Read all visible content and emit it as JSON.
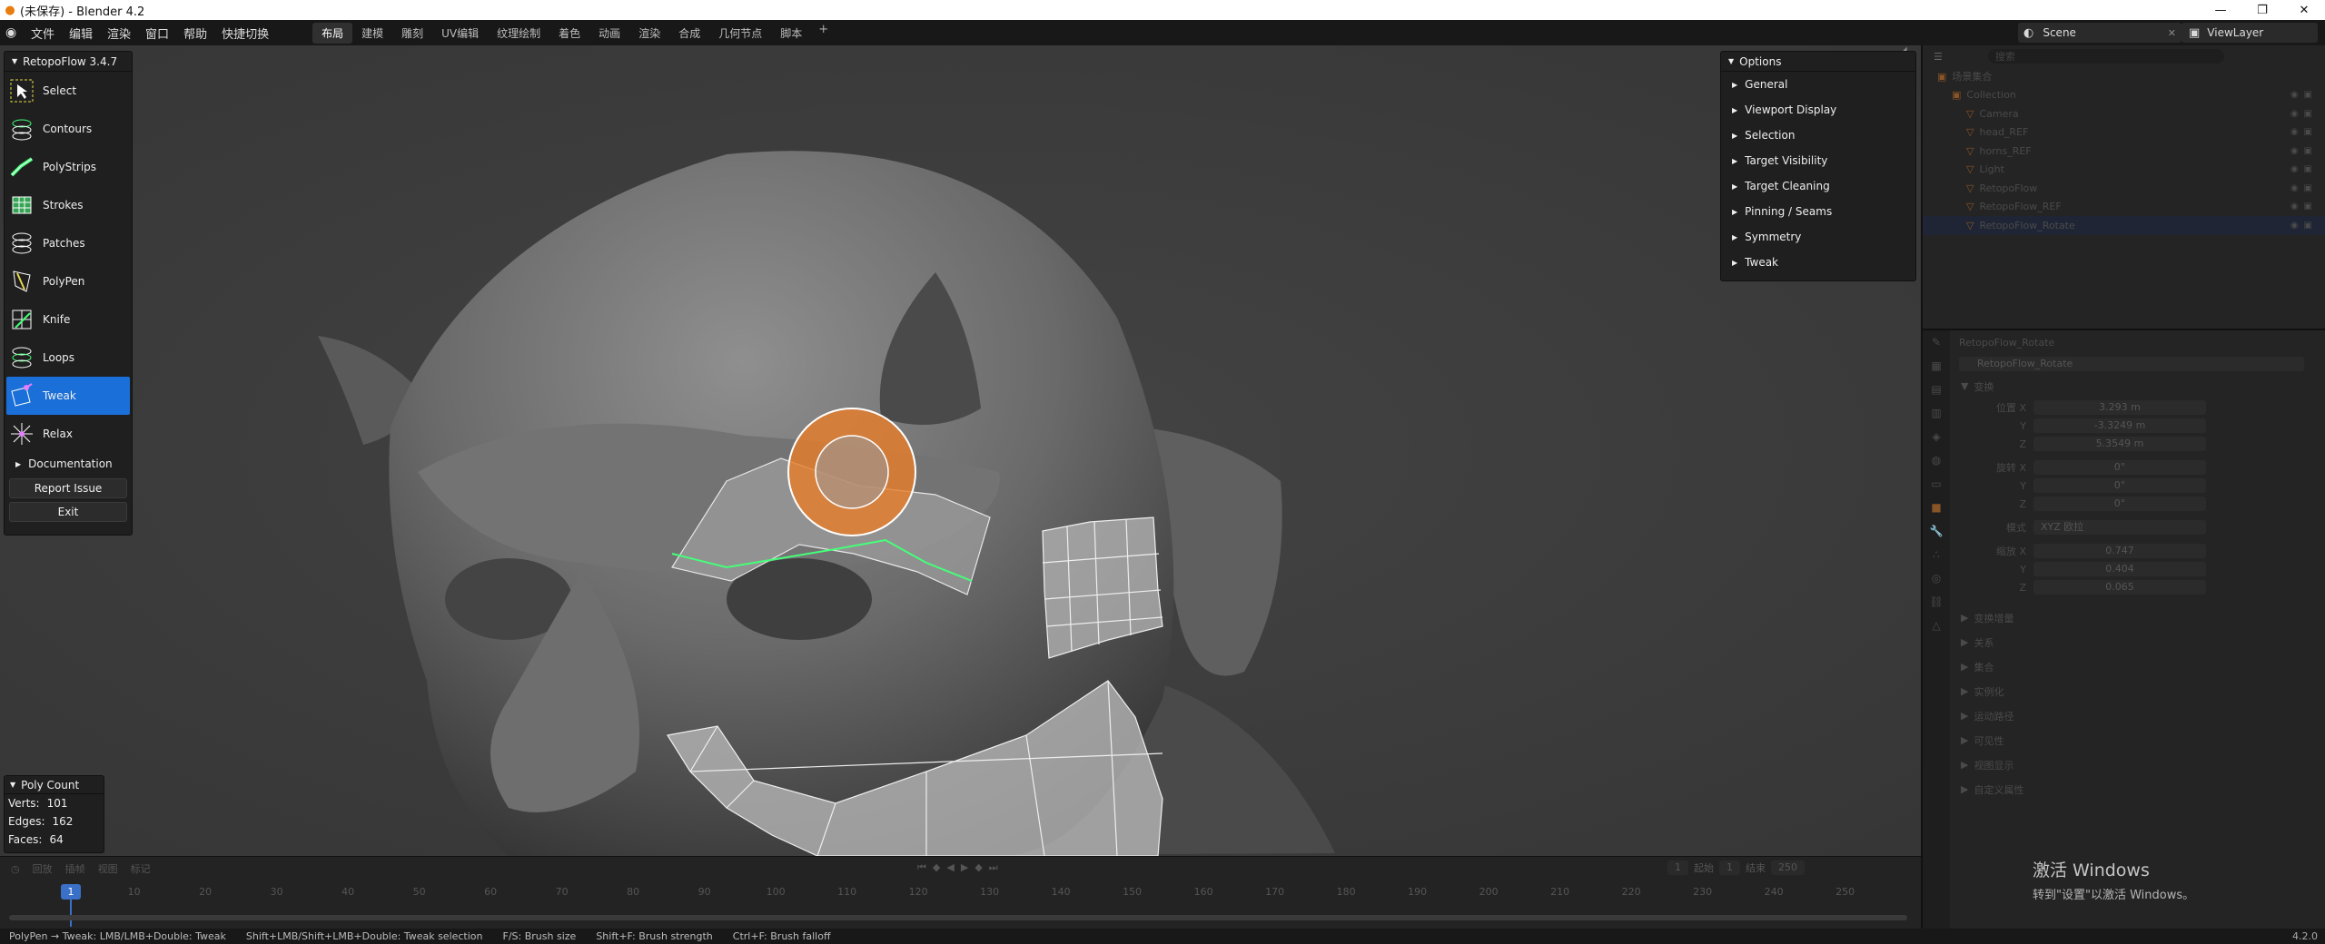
{
  "window": {
    "title": "(未保存) - Blender 4.2",
    "controls": [
      "—",
      "❐",
      "✕"
    ]
  },
  "menubar": {
    "menus": [
      "文件",
      "编辑",
      "渲染",
      "窗口",
      "帮助",
      "快捷切换"
    ],
    "workspaces": [
      "布局",
      "建模",
      "雕刻",
      "UV编辑",
      "纹理绘制",
      "着色",
      "动画",
      "渲染",
      "合成",
      "几何节点",
      "脚本"
    ],
    "active_workspace": "布局",
    "scene": "Scene",
    "view_layer": "ViewLayer"
  },
  "rf_panel": {
    "title": "RetopoFlow 3.4.7",
    "tools": [
      {
        "label": "Select",
        "icon": "select-icon"
      },
      {
        "label": "Contours",
        "icon": "contours-icon"
      },
      {
        "label": "PolyStrips",
        "icon": "polystrips-icon"
      },
      {
        "label": "Strokes",
        "icon": "strokes-icon"
      },
      {
        "label": "Patches",
        "icon": "patches-icon"
      },
      {
        "label": "PolyPen",
        "icon": "polypen-icon"
      },
      {
        "label": "Knife",
        "icon": "knife-icon"
      },
      {
        "label": "Loops",
        "icon": "loops-icon"
      },
      {
        "label": "Tweak",
        "icon": "tweak-icon"
      },
      {
        "label": "Relax",
        "icon": "relax-icon"
      }
    ],
    "active_tool": "Tweak",
    "documentation": "Documentation",
    "report_issue": "Report Issue",
    "exit": "Exit"
  },
  "options_panel": {
    "title": "Options",
    "items": [
      "General",
      "Viewport Display",
      "Selection",
      "Target Visibility",
      "Target Cleaning",
      "Pinning / Seams",
      "Symmetry",
      "Tweak"
    ]
  },
  "poly_count": {
    "title": "Poly Count",
    "verts_label": "Verts:",
    "verts": "101",
    "edges_label": "Edges:",
    "edges": "162",
    "faces_label": "Faces:",
    "faces": "64"
  },
  "timeline": {
    "menus": [
      "回放",
      "插帧",
      "视图",
      "标记"
    ],
    "current_frame": "1",
    "start_label": "起始",
    "start": "1",
    "end_label": "结束",
    "end": "250",
    "ticks": [
      "10",
      "20",
      "30",
      "40",
      "50",
      "60",
      "70",
      "80",
      "90",
      "100",
      "110",
      "120",
      "130",
      "140",
      "150",
      "160",
      "170",
      "180",
      "190",
      "200",
      "210",
      "220",
      "230",
      "240",
      "250"
    ]
  },
  "statusbar": {
    "hints": [
      "PolyPen → Tweak: LMB/LMB+Double: Tweak",
      "Shift+LMB/Shift+LMB+Double: Tweak selection",
      "F/S: Brush size",
      "Shift+F: Brush strength",
      "Ctrl+F: Brush falloff"
    ],
    "version": "4.2.0"
  },
  "outliner": {
    "search_placeholder": "搜索",
    "rows": [
      {
        "label": "场景集合",
        "indent": 0
      },
      {
        "label": "Collection",
        "indent": 1
      },
      {
        "label": "Camera",
        "indent": 2
      },
      {
        "label": "head_REF",
        "indent": 2
      },
      {
        "label": "horns_REF",
        "indent": 2
      },
      {
        "label": "Light",
        "indent": 2
      },
      {
        "label": "RetopoFlow",
        "indent": 2
      },
      {
        "label": "RetopoFlow_REF",
        "indent": 2
      },
      {
        "label": "RetopoFlow_Rotate",
        "indent": 2
      }
    ]
  },
  "properties": {
    "object_name": "RetopoFlow_Rotate",
    "object_field": "RetopoFlow_Rotate",
    "transform_label": "变换",
    "location_label": "位置 X",
    "location": [
      "3.293 m",
      "-3.3249 m",
      "5.3549 m"
    ],
    "rotation_label": "旋转 X",
    "rotation": [
      "0°",
      "0°",
      "0°"
    ],
    "mode_label": "模式",
    "mode": "XYZ 欧拉",
    "scale_label": "缩放 X",
    "scale": [
      "0.747",
      "0.404",
      "0.065"
    ],
    "axis_y": "Y",
    "axis_z": "Z",
    "sections": [
      "变换增量",
      "关系",
      "集合",
      "实例化",
      "运动路径",
      "可见性",
      "视图显示",
      "自定义属性"
    ]
  },
  "activation": {
    "line1": "激活 Windows",
    "line2": "转到\"设置\"以激活 Windows。"
  },
  "colors": {
    "accent_blue": "#1a6fd8",
    "brush_orange": "#e87d2a",
    "retopo_green": "#45ff7a"
  }
}
